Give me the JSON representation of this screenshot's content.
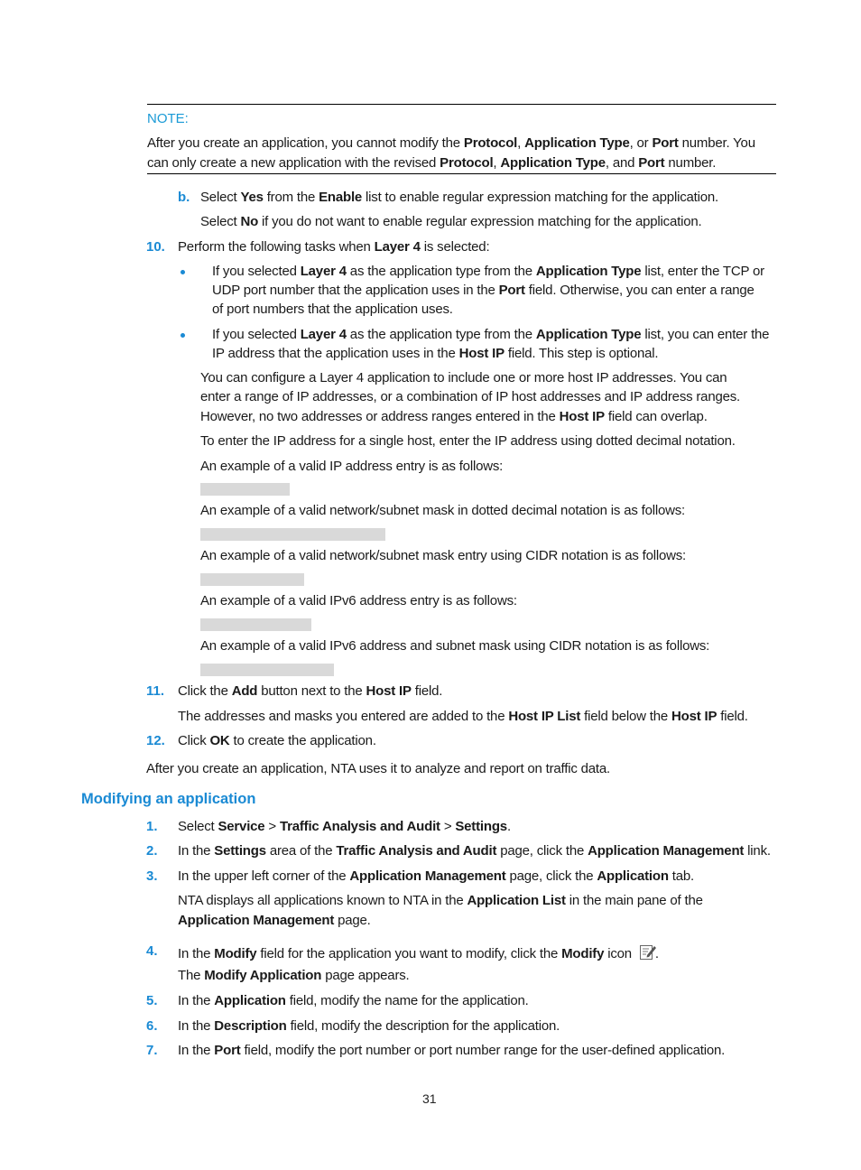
{
  "note": {
    "label": "NOTE:",
    "lines": [
      [
        "After you create an application, you cannot modify the ",
        {
          "b": "Protocol"
        },
        ", ",
        {
          "b": "Application Type"
        },
        ", or ",
        {
          "b": "Port"
        },
        " number. You"
      ],
      [
        "can only create a new application with the revised ",
        {
          "b": "Protocol"
        },
        ", ",
        {
          "b": "Application Type"
        },
        ", and ",
        {
          "b": "Port"
        },
        " number."
      ]
    ]
  },
  "step_b": {
    "marker": "b.",
    "line1": [
      "Select ",
      {
        "b": "Yes"
      },
      " from the ",
      {
        "b": "Enable"
      },
      " list to enable regular expression matching for the application."
    ],
    "line2": [
      "Select ",
      {
        "b": "No"
      },
      " if you do not want to enable regular expression matching for the application."
    ]
  },
  "step10": {
    "marker": "10.",
    "text": [
      "Perform the following tasks when ",
      {
        "b": "Layer 4"
      },
      " is selected:"
    ],
    "bullet1": [
      [
        "If you selected ",
        {
          "b": "Layer 4"
        },
        " as the application type from the ",
        {
          "b": "Application Type"
        },
        " list, enter the TCP or"
      ],
      [
        "UDP port number that the application uses in the ",
        {
          "b": "Port"
        },
        " field. Otherwise, you can enter a range"
      ],
      [
        "of port numbers that the application uses."
      ]
    ],
    "bullet2": [
      [
        "If you selected ",
        {
          "b": "Layer 4"
        },
        " as the application type from the ",
        {
          "b": "Application Type"
        },
        " list, you can enter the"
      ],
      [
        "IP address that the application uses in the ",
        {
          "b": "Host IP"
        },
        " field. This step is optional."
      ]
    ],
    "para1": [
      [
        "You can configure a Layer 4 application to include one or more host IP addresses. You can"
      ],
      [
        "enter a range of IP addresses, or a combination of IP host addresses and IP address ranges."
      ],
      [
        "However, no two addresses or address ranges entered in the ",
        {
          "b": "Host IP"
        },
        " field can overlap."
      ]
    ],
    "para2": [
      "To enter the IP address for a single host, enter the IP address using dotted decimal notation."
    ],
    "examples": [
      "An example of a valid IP address entry is as follows:",
      "An example of a valid network/subnet mask in dotted decimal notation is as follows:",
      "An example of a valid network/subnet mask entry using CIDR notation is as follows:",
      "An example of a valid IPv6 address entry is as follows:",
      "An example of a valid IPv6 address and subnet mask using CIDR notation is as follows:"
    ]
  },
  "step11": {
    "marker": "11.",
    "text": [
      "Click the ",
      {
        "b": "Add"
      },
      " button next to the ",
      {
        "b": "Host IP"
      },
      " field."
    ],
    "sub": [
      "The addresses and masks you entered are added to the ",
      {
        "b": "Host IP List"
      },
      " field below the ",
      {
        "b": "Host IP"
      },
      " field."
    ]
  },
  "step12": {
    "marker": "12.",
    "text": [
      "Click ",
      {
        "b": "OK"
      },
      " to create the application."
    ]
  },
  "after_para": [
    "After you create an application, NTA uses it to analyze and report on traffic data."
  ],
  "section_heading": "Modifying an application",
  "modify_steps": [
    {
      "marker": "1.",
      "text": [
        "Select ",
        {
          "b": "Service"
        },
        " > ",
        {
          "b": "Traffic Analysis and Audit"
        },
        " > ",
        {
          "b": "Settings"
        },
        "."
      ]
    },
    {
      "marker": "2.",
      "text": [
        "In the ",
        {
          "b": "Settings"
        },
        " area of the ",
        {
          "b": "Traffic Analysis and Audit"
        },
        " page, click the ",
        {
          "b": "Application Management"
        },
        " link."
      ]
    },
    {
      "marker": "3.",
      "text": [
        "In the upper left corner of the ",
        {
          "b": "Application Management"
        },
        " page, click the ",
        {
          "b": "Application"
        },
        " tab."
      ]
    },
    {
      "marker": "",
      "text": [
        "NTA displays all applications known to NTA in the ",
        {
          "b": "Application List"
        },
        " in the main pane of the"
      ]
    },
    {
      "marker": "",
      "text": [
        {
          "b": "Application Management"
        },
        " page."
      ]
    },
    {
      "marker": "4.",
      "text": [
        "In the ",
        {
          "b": "Modify"
        },
        " field for the application you want to modify, click the ",
        {
          "b": "Modify"
        },
        " icon"
      ]
    },
    {
      "marker": "",
      "text": [
        "The ",
        {
          "b": "Modify Application"
        },
        " page appears."
      ]
    },
    {
      "marker": "5.",
      "text": [
        "In the ",
        {
          "b": "Application"
        },
        " field, modify the name for the application."
      ]
    },
    {
      "marker": "6.",
      "text": [
        "In the ",
        {
          "b": "Description"
        },
        " field, modify the description for the application."
      ]
    },
    {
      "marker": "7.",
      "text": [
        "In the ",
        {
          "b": "Port"
        },
        " field, modify the port number or port number range for the user-defined application."
      ]
    }
  ],
  "icons": {
    "modify": "modify-edit-icon",
    "bullet": "bullet-dot-icon"
  },
  "page_number": "31",
  "colors": {
    "accent": "#1a8ad4",
    "redaction": "#d9d9d9"
  }
}
